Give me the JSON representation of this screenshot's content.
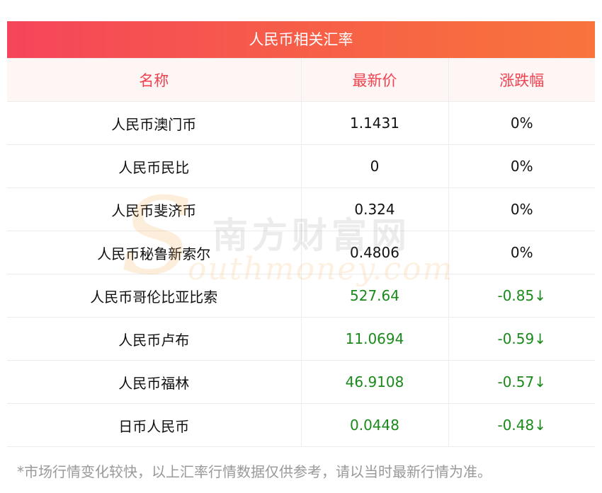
{
  "title": "人民币相关汇率",
  "headers": [
    "名称",
    "最新价",
    "涨跌幅"
  ],
  "rows": [
    {
      "name": "人民币澳门币",
      "price": "1.1431",
      "change": "0%",
      "trend": "flat"
    },
    {
      "name": "人民币民比",
      "price": "0",
      "change": "0%",
      "trend": "flat"
    },
    {
      "name": "人民币斐济币",
      "price": "0.324",
      "change": "0%",
      "trend": "flat"
    },
    {
      "name": "人民币秘鲁新索尔",
      "price": "0.4806",
      "change": "0%",
      "trend": "flat"
    },
    {
      "name": "人民币哥伦比亚比索",
      "price": "527.64",
      "change": "-0.85↓",
      "trend": "down"
    },
    {
      "name": "人民币卢布",
      "price": "11.0694",
      "change": "-0.59↓",
      "trend": "down"
    },
    {
      "name": "人民币福林",
      "price": "46.9108",
      "change": "-0.57↓",
      "trend": "down"
    },
    {
      "name": "日币人民币",
      "price": "0.0448",
      "change": "-0.48↓",
      "trend": "down"
    }
  ],
  "footnote": "*市场行情变化较快，以上汇率行情数据仅供参考，请以当时最新行情为准。",
  "watermark": {
    "letter": "S",
    "cn": "南方财富网",
    "en": "outhmoney.com"
  },
  "colors": {
    "header_text": "#f0414f",
    "down": "#1a8a1a",
    "title_start": "#f5455a",
    "title_end": "#f8743c"
  }
}
